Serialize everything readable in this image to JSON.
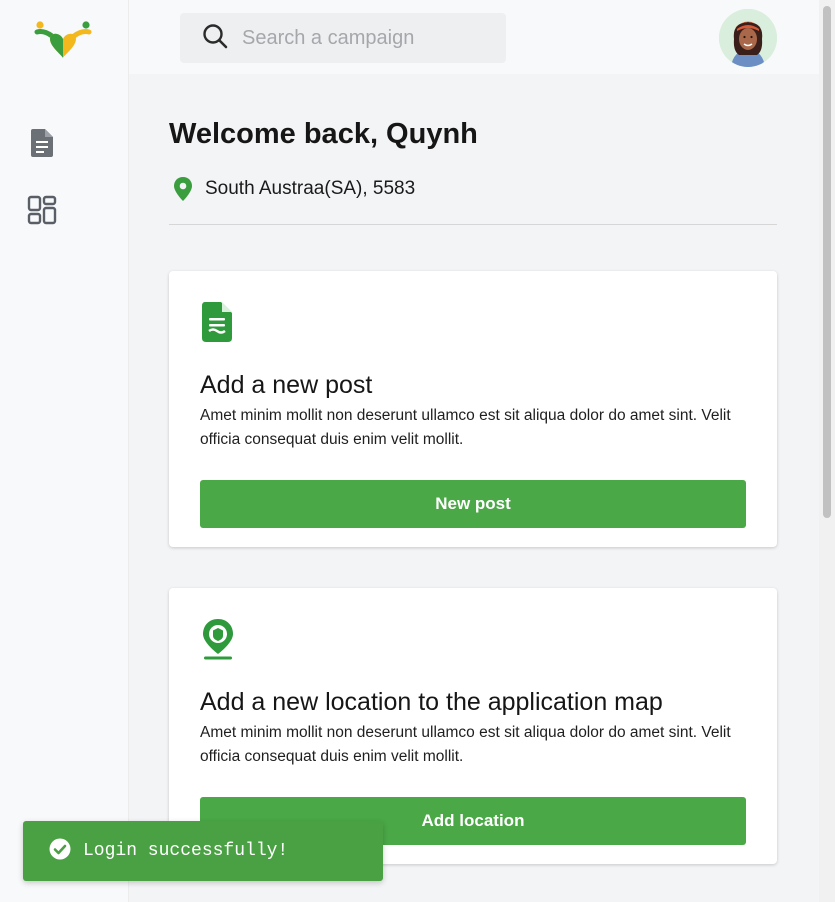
{
  "sidebar": {
    "logo_icon": "heart-people-logo",
    "items": [
      {
        "icon": "document-icon"
      },
      {
        "icon": "dashboard-icon"
      }
    ]
  },
  "header": {
    "search": {
      "placeholder": "Search a campaign",
      "value": ""
    },
    "avatar_icon": "user-avatar"
  },
  "main": {
    "welcome": "Welcome back, Quynh",
    "location": "South Austraa(SA), 5583",
    "cards": [
      {
        "icon": "green-document-icon",
        "title": "Add a new post",
        "description": "Amet minim mollit non deserunt ullamco est sit aliqua dolor do amet sint. Velit officia consequat duis enim velit mollit.",
        "button_label": "New post"
      },
      {
        "icon": "map-pin-icon",
        "title": "Add a new location to the application map",
        "description": "Amet minim mollit non deserunt ullamco est sit aliqua dolor do amet sint. Velit officia consequat duis enim velit mollit.",
        "button_label": "Add location"
      }
    ]
  },
  "toast": {
    "message": "Login successfully!",
    "icon": "check-circle-icon"
  },
  "colors": {
    "primary_green": "#4aa846",
    "icon_green": "#2e9a3c",
    "toast_green": "#4aa143",
    "text_dark": "#161616"
  }
}
